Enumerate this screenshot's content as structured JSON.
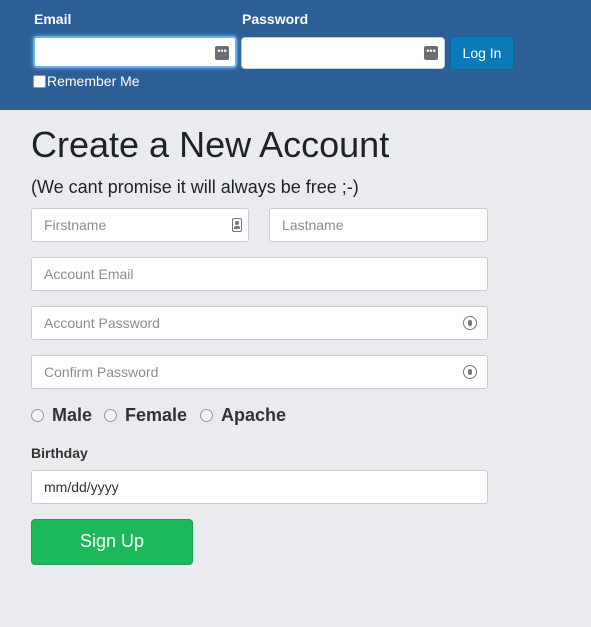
{
  "login": {
    "email_label": "Email",
    "password_label": "Password",
    "email_value": "",
    "password_value": "",
    "login_button": "Log In",
    "remember_me": "Remember Me"
  },
  "signup": {
    "title": "Create a New Account",
    "subtitle": "(We cant promise it will always be free ;-)",
    "firstname_placeholder": "Firstname",
    "lastname_placeholder": "Lastname",
    "email_placeholder": "Account Email",
    "password_placeholder": "Account Password",
    "confirm_placeholder": "Confirm Password",
    "genders": [
      "Male",
      "Female",
      "Apache"
    ],
    "birthday_label": "Birthday",
    "birthday_value": "mm/dd/yyyy",
    "signup_button": "Sign Up"
  },
  "colors": {
    "header_bg": "#2d5f97",
    "page_bg": "#e9ebee",
    "login_button_bg": "#0a7ab8",
    "signup_button_bg": "#1cb85a",
    "focus_ring": "#66afe9"
  },
  "icons": {
    "credential_icon": "key-icon",
    "contact_icon": "contact-card-icon",
    "password_icon": "password-lock-icon"
  }
}
